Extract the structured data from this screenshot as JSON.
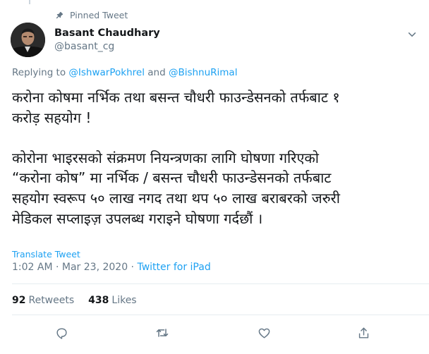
{
  "pinned_label": "Pinned Tweet",
  "author": {
    "name": "Basant Chaudhary",
    "handle": "@basant_cg"
  },
  "replying": {
    "prefix": "Replying to ",
    "user1": "@IshwarPokhrel",
    "joiner": " and ",
    "user2": "@BishnuRimal"
  },
  "tweet_text": "करोना कोषमा नर्भिक तथा बसन्त चौधरी फाउन्डेसनको तर्फबाट १\nकरोड़ सहयोग !\n\nकोरोना भाइरसको संक्रमण नियन्त्रणका लागि घोषणा गरिएको\n“करोना कोष” मा नर्भिक / बसन्त चौधरी फाउन्डेसनको तर्फबाट\nसहयोग स्वरूप ५० लाख नगद तथा थप ५० लाख बराबरको जरुरी\nमेडिकल सप्लाइज़ उपलब्ध गराइने घोषणा गर्दछौं ।",
  "translate_label": "Translate Tweet",
  "timestamp": "1:02 AM · Mar 23, 2020 · ",
  "source": "Twitter for iPad",
  "stats": {
    "retweets_count": "92",
    "retweets_label": "Retweets",
    "likes_count": "438",
    "likes_label": "Likes"
  },
  "colors": {
    "link": "#1da1f2",
    "muted": "#657786",
    "text": "#14171a",
    "divider": "#e6ecf0"
  },
  "icons": [
    "pin-icon",
    "chevron-down-icon",
    "reply-icon",
    "retweet-icon",
    "like-icon",
    "share-icon"
  ]
}
